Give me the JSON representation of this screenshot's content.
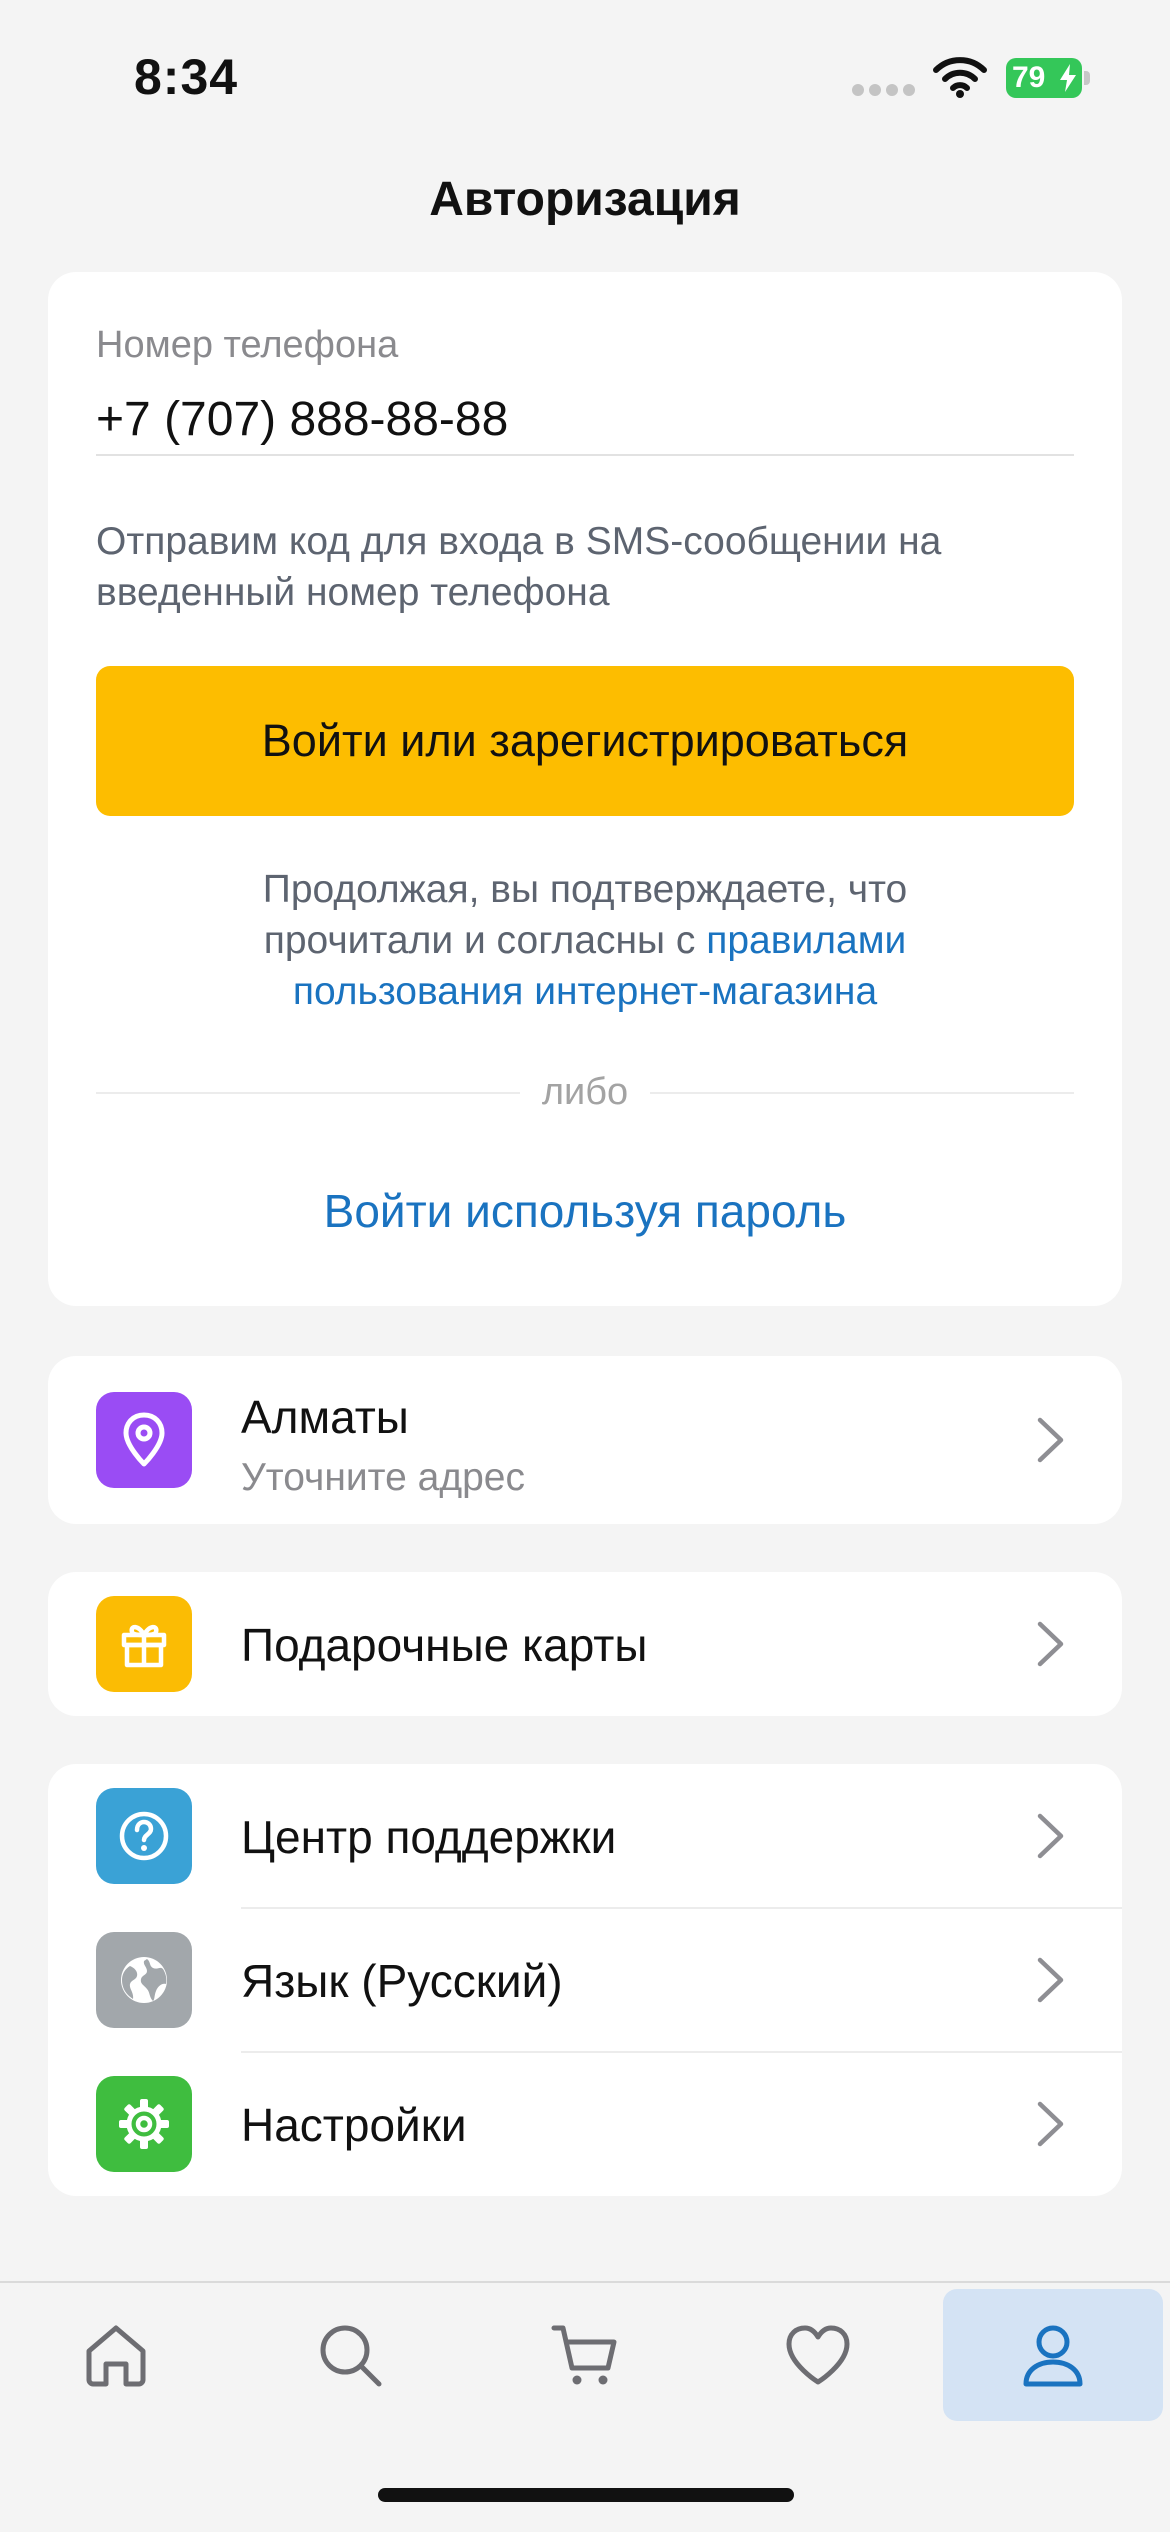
{
  "status_bar": {
    "time": "8:34",
    "battery_level": "79",
    "battery_color": "#34c759"
  },
  "header": {
    "title": "Авторизация"
  },
  "auth": {
    "phone_label": "Номер телефона",
    "phone_value": "+7 (707) 888-88-88",
    "sms_hint": "Отправим код для входа в SMS-сообщении на введенный номер телефона",
    "submit_label": "Войти или зарегистрироваться",
    "terms_prefix": "Продолжая, вы подтверждаете, что прочитали и согласны с ",
    "terms_link": "правилами пользования интернет-магазина",
    "divider_label": "либо",
    "password_login_label": "Войти используя пароль"
  },
  "city": {
    "name": "Алматы",
    "subtitle": "Уточните адрес",
    "icon": "location-pin-icon"
  },
  "menu": {
    "gift_cards": "Подарочные карты",
    "support_center": "Центр поддержки",
    "language": "Язык (Русский)",
    "settings": "Настройки"
  },
  "tabs": [
    {
      "icon": "home-icon",
      "active": false
    },
    {
      "icon": "search-icon",
      "active": false
    },
    {
      "icon": "cart-icon",
      "active": false
    },
    {
      "icon": "heart-icon",
      "active": false
    },
    {
      "icon": "profile-icon",
      "active": true
    }
  ],
  "colors": {
    "accent_yellow": "#fdbd00",
    "link_blue": "#1a73c0",
    "location_purple": "#9a4cf4",
    "gift_yellow": "#fbbc04",
    "support_blue": "#3aa2d6",
    "language_gray": "#a2a7ab",
    "settings_green": "#3fbd3f",
    "tab_active_bg": "#d4e3f4"
  }
}
